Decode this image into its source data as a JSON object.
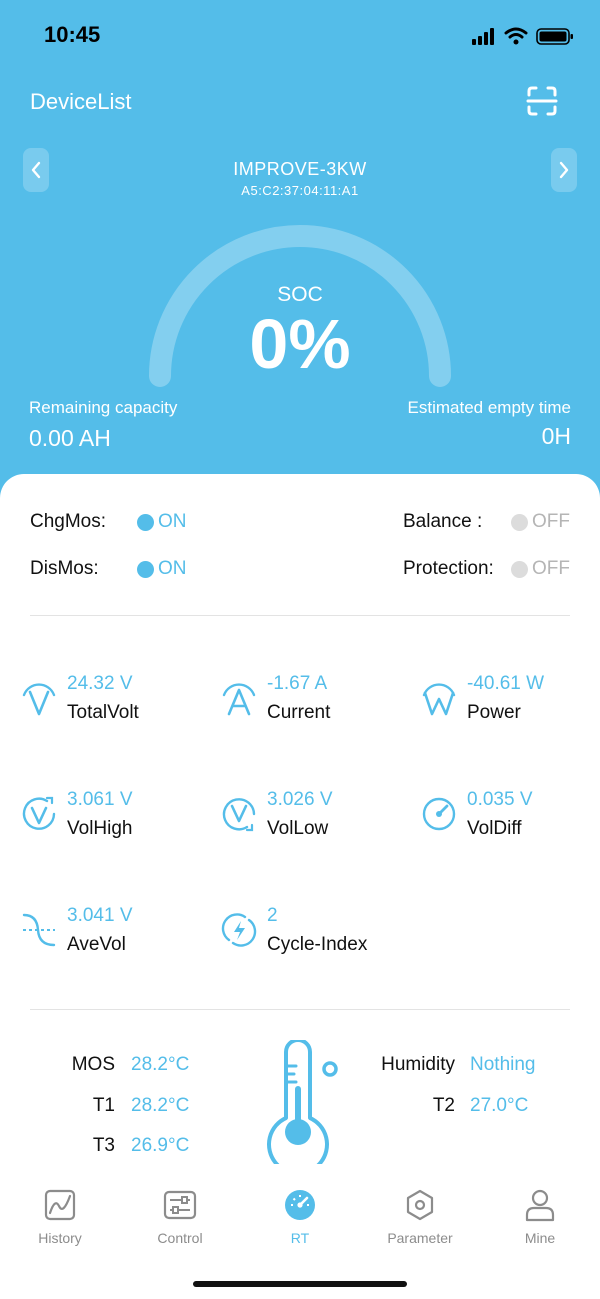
{
  "status_bar": {
    "time": "10:45"
  },
  "header": {
    "title": "DeviceList",
    "scan_icon": "scan-icon",
    "device_name": "IMPROVE-3KW",
    "device_mac": "A5:C2:37:04:11:A1",
    "prev_icon": "chevron-left-icon",
    "next_icon": "chevron-right-icon"
  },
  "soc": {
    "label": "SOC",
    "value": "0%",
    "level": 0.0
  },
  "capacity": {
    "label": "Remaining capacity",
    "value": "0.00 AH"
  },
  "empty_time": {
    "label": "Estimated empty time",
    "value": "0H"
  },
  "status": {
    "chgmos": {
      "label": "ChgMos:",
      "state": "ON"
    },
    "dismos": {
      "label": "DisMos:",
      "state": "ON"
    },
    "balance": {
      "label": "Balance :",
      "state": "OFF"
    },
    "protection": {
      "label": "Protection:",
      "state": "OFF"
    }
  },
  "metrics": [
    {
      "value": "24.32 V",
      "label": "TotalVolt",
      "icon": "voltage-icon"
    },
    {
      "value": "-1.67 A",
      "label": "Current",
      "icon": "current-icon"
    },
    {
      "value": "-40.61 W",
      "label": "Power",
      "icon": "power-icon"
    },
    {
      "value": "3.061 V",
      "label": "VolHigh",
      "icon": "voltage-high-icon"
    },
    {
      "value": "3.026 V",
      "label": "VolLow",
      "icon": "voltage-low-icon"
    },
    {
      "value": "0.035 V",
      "label": "VolDiff",
      "icon": "gauge-icon"
    },
    {
      "value": "3.041 V",
      "label": "AveVol",
      "icon": "wave-icon"
    },
    {
      "value": "2",
      "label": "Cycle-Index",
      "icon": "cycle-icon"
    }
  ],
  "temps": {
    "mos": {
      "label": "MOS",
      "value": "28.2°C"
    },
    "t1": {
      "label": "T1",
      "value": "28.2°C"
    },
    "t3": {
      "label": "T3",
      "value": "26.9°C"
    },
    "humidity": {
      "label": "Humidity",
      "value": "Nothing"
    },
    "t2": {
      "label": "T2",
      "value": "27.0°C"
    }
  },
  "tabs": [
    {
      "label": "History",
      "icon": "chart-icon",
      "active": false
    },
    {
      "label": "Control",
      "icon": "sliders-icon",
      "active": false
    },
    {
      "label": "RT",
      "icon": "speedometer-icon",
      "active": true
    },
    {
      "label": "Parameter",
      "icon": "hexagon-icon",
      "active": false
    },
    {
      "label": "Mine",
      "icon": "user-icon",
      "active": false
    }
  ],
  "colors": {
    "accent": "#54bde9",
    "off": "#dcdcdc",
    "text": "#111111",
    "muted": "#8c8c8c"
  }
}
